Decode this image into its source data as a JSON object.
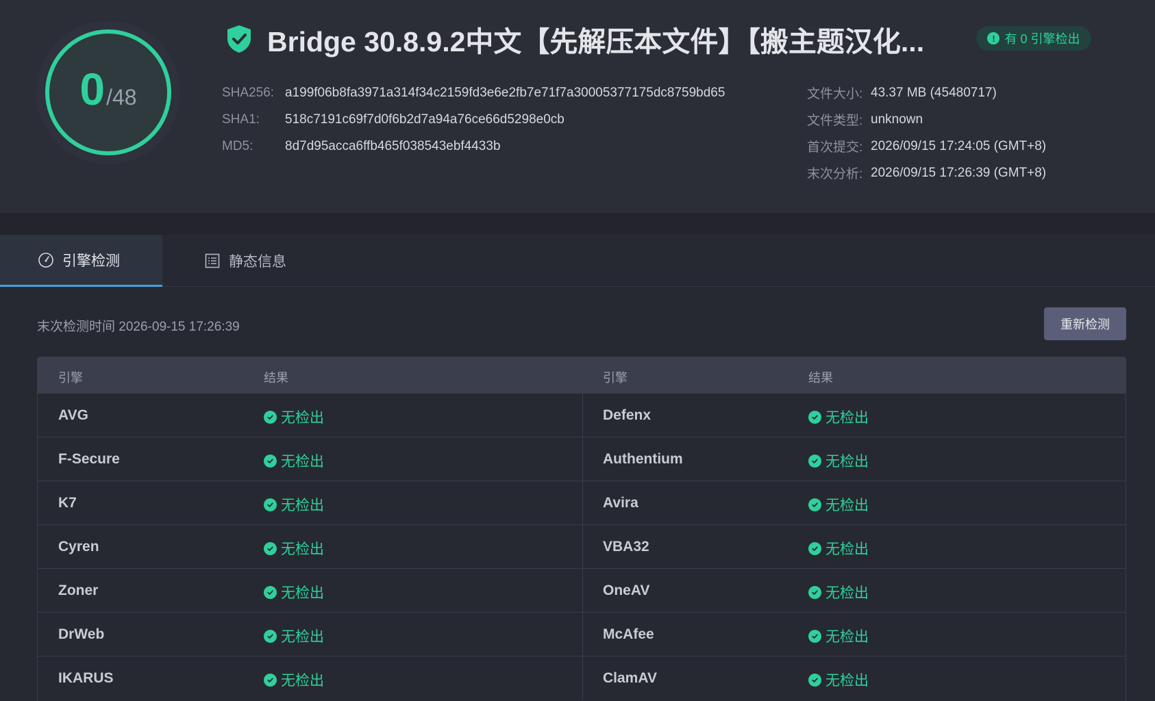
{
  "score": {
    "detected": "0",
    "total": "/48"
  },
  "title": "Bridge 30.8.9.2中文【先解压本文件】【搬主题汉化...",
  "badge": "有 0 引擎检出",
  "hashes": [
    {
      "key": "SHA256:",
      "value": "a199f06b8fa3971a314f34c2159fd3e6e2fb7e71f7a30005377175dc8759bd65"
    },
    {
      "key": "SHA1:",
      "value": "518c7191c69f7d0f6b2d7a94a76ce66d5298e0cb"
    },
    {
      "key": "MD5:",
      "value": "8d7d95acca6ffb465f038543ebf4433b"
    }
  ],
  "meta": [
    {
      "key": "文件大小:",
      "value": "43.37 MB (45480717)"
    },
    {
      "key": "文件类型:",
      "value": "unknown"
    },
    {
      "key": "首次提交:",
      "value": "2026/09/15 17:24:05 (GMT+8)"
    },
    {
      "key": "末次分析:",
      "value": "2026/09/15 17:26:39 (GMT+8)"
    }
  ],
  "tabs": {
    "engine": "引擎检测",
    "static": "静态信息"
  },
  "scan_time": "末次检测时间 2026-09-15 17:26:39",
  "rescan_label": "重新检测",
  "table": {
    "col_engine": "引擎",
    "col_result": "结果",
    "result_text": "无检出",
    "rows": [
      {
        "left": "AVG",
        "right": "Defenx"
      },
      {
        "left": "F-Secure",
        "right": "Authentium"
      },
      {
        "left": "K7",
        "right": "Avira"
      },
      {
        "left": "Cyren",
        "right": "VBA32"
      },
      {
        "left": "Zoner",
        "right": "OneAV"
      },
      {
        "left": "DrWeb",
        "right": "McAfee"
      },
      {
        "left": "IKARUS",
        "right": "ClamAV"
      }
    ]
  },
  "colors": {
    "accent": "#2fd09b",
    "tab_underline": "#3fa1e0",
    "button": "#5a5e78"
  },
  "icons": {
    "shield": "shield-check-icon",
    "alert": "alert-circle-icon",
    "engine_tab": "gauge-icon",
    "static_tab": "list-icon",
    "result": "check-circle-icon"
  }
}
